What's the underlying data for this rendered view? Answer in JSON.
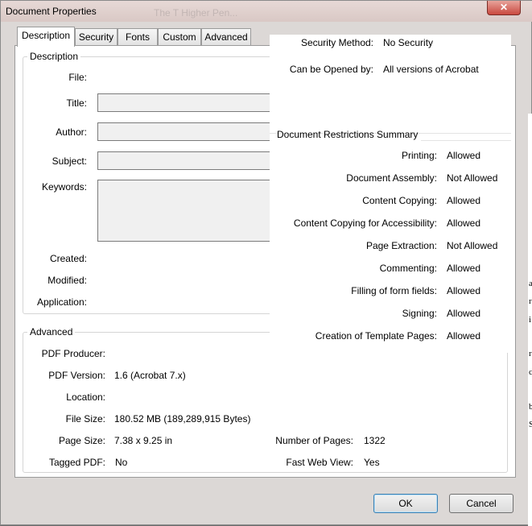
{
  "window": {
    "title": "Document Properties",
    "ghost_title": "The T Higher Pen...",
    "close_glyph": "✕"
  },
  "tabs": [
    {
      "label": "Description"
    },
    {
      "label": "Security"
    },
    {
      "label": "Fonts"
    },
    {
      "label": "Custom"
    },
    {
      "label": "Advanced"
    }
  ],
  "description": {
    "group_title": "Description",
    "file_label": "File:",
    "title_label": "Title:",
    "author_label": "Author:",
    "subject_label": "Subject:",
    "keywords_label": "Keywords:",
    "created_label": "Created:",
    "modified_label": "Modified:",
    "application_label": "Application:"
  },
  "advanced": {
    "group_title": "Advanced",
    "pdf_producer_label": "PDF Producer:",
    "pdf_version_label": "PDF Version:",
    "pdf_version_value": "1.6 (Acrobat 7.x)",
    "location_label": "Location:",
    "file_size_label": "File Size:",
    "file_size_value": "180.52 MB (189,289,915 Bytes)",
    "page_size_label": "Page Size:",
    "page_size_value": "7.38 x 9.25 in",
    "tagged_pdf_label": "Tagged PDF:",
    "tagged_pdf_value": "No",
    "num_pages_label": "Number of Pages:",
    "num_pages_value": "1322",
    "fast_web_view_label": "Fast Web View:",
    "fast_web_view_value": "Yes"
  },
  "security": {
    "method_label": "Security Method:",
    "method_value": "No Security",
    "opened_by_label": "Can be Opened by:",
    "opened_by_value": "All versions of Acrobat",
    "restrictions_title": "Document Restrictions Summary",
    "restrictions": [
      {
        "label": "Printing:",
        "value": "Allowed"
      },
      {
        "label": "Document Assembly:",
        "value": "Not Allowed"
      },
      {
        "label": "Content Copying:",
        "value": "Allowed"
      },
      {
        "label": "Content Copying for Accessibility:",
        "value": "Allowed"
      },
      {
        "label": "Page Extraction:",
        "value": "Not Allowed"
      },
      {
        "label": "Commenting:",
        "value": "Allowed"
      },
      {
        "label": "Filling of form fields:",
        "value": "Allowed"
      },
      {
        "label": "Signing:",
        "value": "Allowed"
      },
      {
        "label": "Creation of Template Pages:",
        "value": "Allowed"
      }
    ]
  },
  "buttons": {
    "ok": "OK",
    "cancel": "Cancel"
  },
  "background_edge_chars": [
    "a",
    "r",
    "i",
    "r",
    "c",
    "b",
    "S"
  ]
}
